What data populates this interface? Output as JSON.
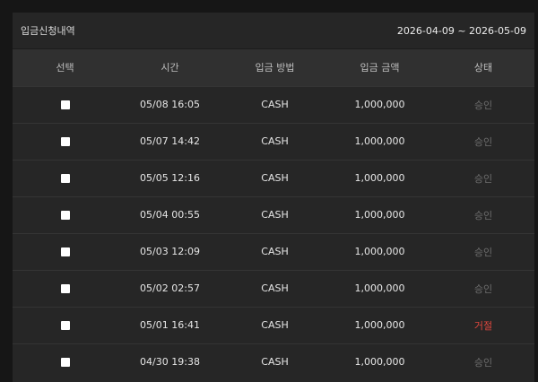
{
  "panel": {
    "title": "입금신청내역",
    "date_range": "2026-04-09 ~ 2026-05-09"
  },
  "columns": [
    "선택",
    "시간",
    "입금 방법",
    "입금 금액",
    "상태"
  ],
  "colors": {
    "approved": "#6d6d6d",
    "rejected": "#e0473e"
  },
  "rows": [
    {
      "time": "05/08 16:05",
      "method": "CASH",
      "amount": "1,000,000",
      "status": "승인",
      "state": "approved"
    },
    {
      "time": "05/07 14:42",
      "method": "CASH",
      "amount": "1,000,000",
      "status": "승인",
      "state": "approved"
    },
    {
      "time": "05/05 12:16",
      "method": "CASH",
      "amount": "1,000,000",
      "status": "승인",
      "state": "approved"
    },
    {
      "time": "05/04 00:55",
      "method": "CASH",
      "amount": "1,000,000",
      "status": "승인",
      "state": "approved"
    },
    {
      "time": "05/03 12:09",
      "method": "CASH",
      "amount": "1,000,000",
      "status": "승인",
      "state": "approved"
    },
    {
      "time": "05/02 02:57",
      "method": "CASH",
      "amount": "1,000,000",
      "status": "승인",
      "state": "approved"
    },
    {
      "time": "05/01 16:41",
      "method": "CASH",
      "amount": "1,000,000",
      "status": "거절",
      "state": "rejected"
    },
    {
      "time": "04/30 19:38",
      "method": "CASH",
      "amount": "1,000,000",
      "status": "승인",
      "state": "approved"
    }
  ]
}
